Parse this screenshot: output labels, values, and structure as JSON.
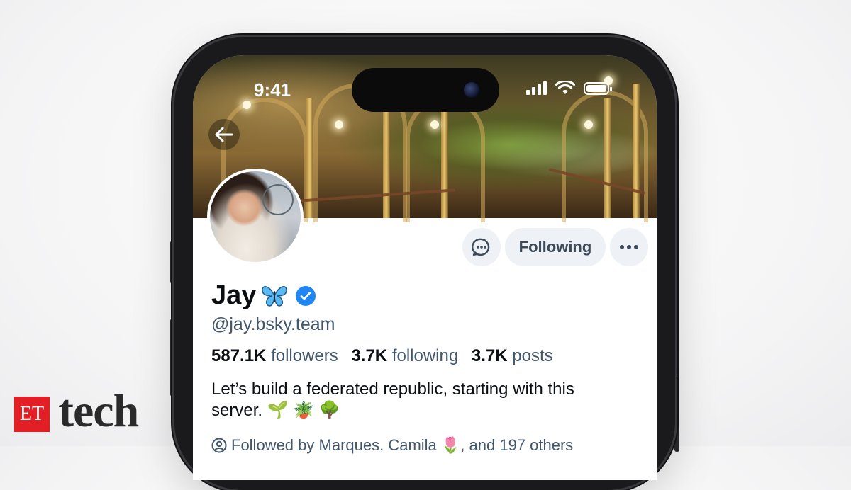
{
  "status_bar": {
    "time": "9:41"
  },
  "profile": {
    "display_name": "Jay",
    "handle": "@jay.bsky.team",
    "followers_count": "587.1K",
    "followers_label": "followers",
    "following_count": "3.7K",
    "following_label": "following",
    "posts_count": "3.7K",
    "posts_label": "posts",
    "bio": "Let’s build a federated republic, starting with this server. 🌱 🪴 🌳",
    "followed_by": "Followed by Marques, Camila 🌷, and 197 others"
  },
  "actions": {
    "follow_label": "Following"
  },
  "branding": {
    "et": "ET",
    "tech": "tech",
    "et_color": "#e31f26"
  },
  "colors": {
    "verified": "#1f86f3",
    "button_bg": "#eef1f5",
    "muted_text": "#42576c"
  },
  "icons": {
    "back": "arrow-left-icon",
    "message": "chat-bubble-icon",
    "more": "more-dots-icon",
    "verified": "verified-check-icon",
    "followed_by": "user-circle-icon"
  }
}
